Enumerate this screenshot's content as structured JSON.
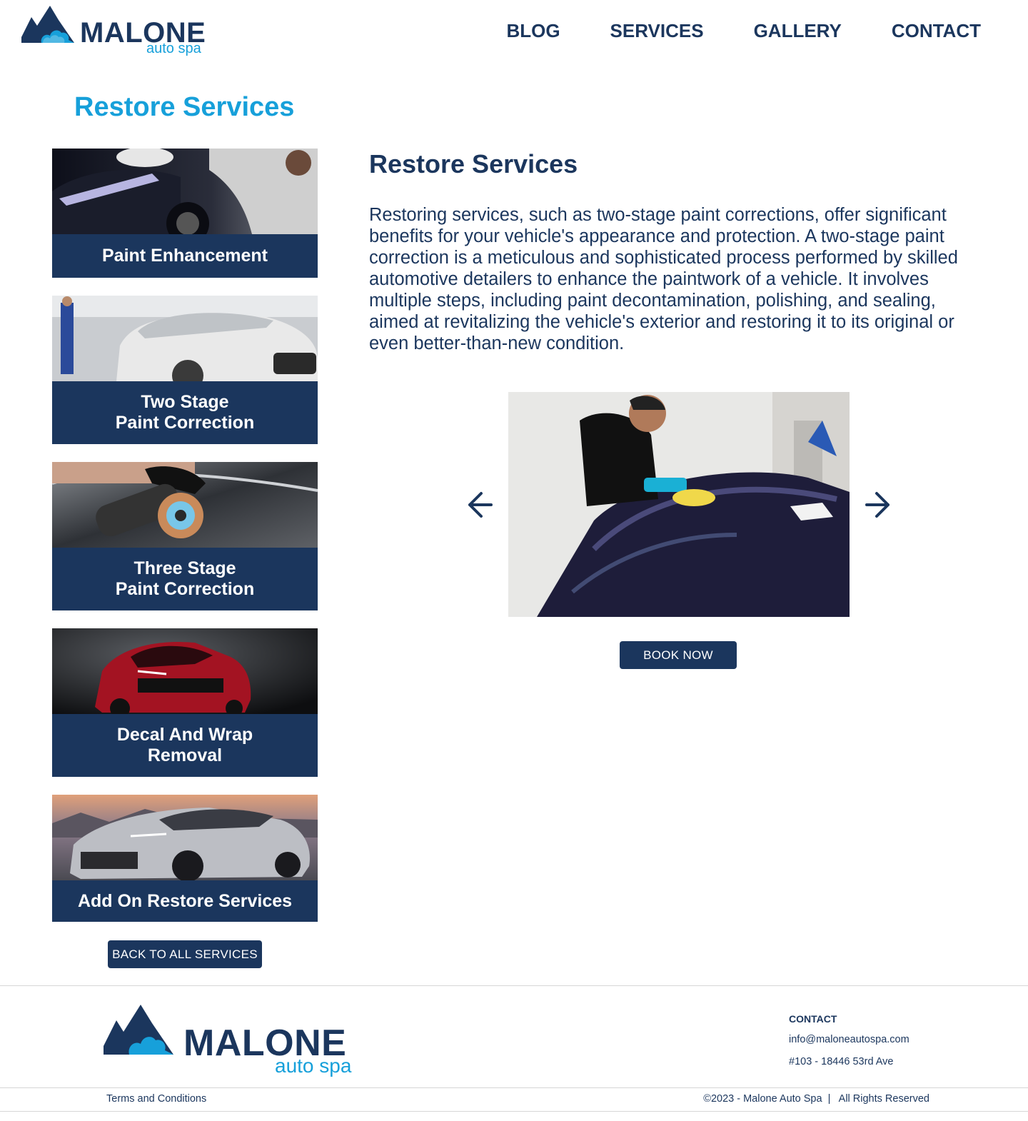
{
  "header": {
    "logo_brand": "MALONE",
    "logo_tag": "auto spa",
    "nav": [
      "BLOG",
      "SERVICES",
      "GALLERY",
      "CONTACT"
    ]
  },
  "sidebar": {
    "title": "Restore Services",
    "cards": [
      {
        "label": "Paint Enhancement"
      },
      {
        "label": "Two Stage\nPaint Correction"
      },
      {
        "label": "Three Stage\nPaint Correction"
      },
      {
        "label": "Decal And Wrap\nRemoval"
      },
      {
        "label": "Add On Restore Services"
      }
    ],
    "back_button": "BACK TO ALL SERVICES"
  },
  "main": {
    "title": "Restore Services",
    "body": "Restoring services, such as two-stage paint corrections, offer significant benefits for your vehicle's appearance and protection. A two-stage paint correction is a meticulous and sophisticated process performed by skilled automotive detailers to enhance the paintwork of a vehicle. It involves multiple steps, including paint decontamination, polishing, and sealing, aimed at revitalizing the vehicle's exterior and restoring it to its original or even better-than-new condition.",
    "book_button": "BOOK NOW"
  },
  "footer": {
    "logo_brand": "MALONE",
    "logo_tag": "auto spa",
    "contact_heading": "CONTACT",
    "email": "info@maloneautospa.com",
    "address": "#103 - 18446 53rd Ave",
    "terms": "Terms and Conditions",
    "copyright": "©2023 - Malone Auto Spa  |   All Rights Reserved"
  },
  "colors": {
    "navy": "#1b365d",
    "accent": "#17a0da"
  }
}
